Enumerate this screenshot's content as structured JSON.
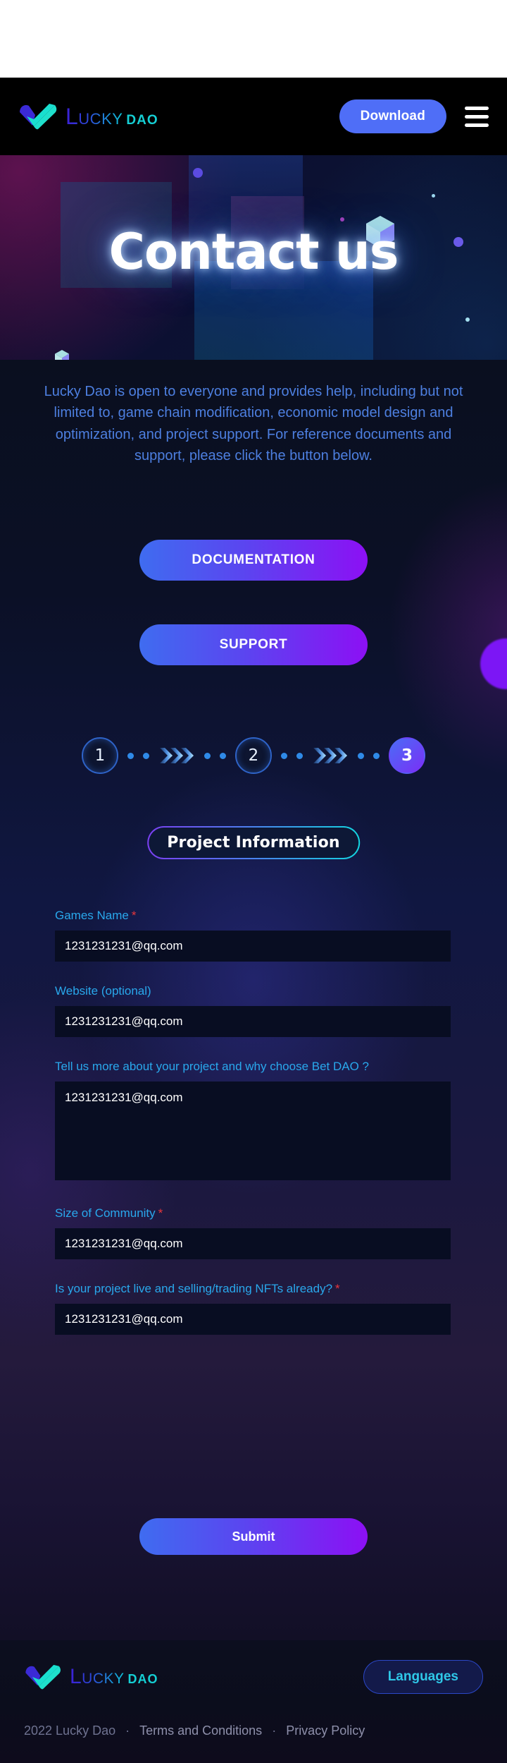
{
  "brand": {
    "name_primary": "Lucky",
    "name_secondary": "DAO",
    "logo_icon": "checkmark-logo-icon"
  },
  "header": {
    "download_label": "Download",
    "menu_icon": "hamburger-menu-icon"
  },
  "hero": {
    "title": "Contact us",
    "cube_icon": "isometric-cube-icon"
  },
  "intro": {
    "paragraph": "Lucky Dao is open to everyone and provides help, including but not limited to, game chain modification, economic model design and optimization, and project support. For reference documents and support, please click the button below."
  },
  "actions": {
    "documentation_label": "DOCUMENTATION",
    "support_label": "SUPPORT"
  },
  "stepper": {
    "steps": [
      {
        "number": "1",
        "state": "idle"
      },
      {
        "number": "2",
        "state": "idle"
      },
      {
        "number": "3",
        "state": "active"
      }
    ],
    "chevron_icon": "chevron-double-right-icon",
    "dot_icon": "progress-dot-icon"
  },
  "section": {
    "tab_label": "Project Information"
  },
  "form": {
    "required_marker": "*",
    "fields": [
      {
        "label": "Games Name",
        "required": true,
        "type": "input",
        "value": "1231231231@qq.com",
        "placeholder": "1231231231@qq.com"
      },
      {
        "label": "Website (optional)",
        "required": false,
        "type": "input",
        "value": "1231231231@qq.com",
        "placeholder": "1231231231@qq.com"
      },
      {
        "label": "Tell us more about your project and why choose Bet DAO ?",
        "required": false,
        "type": "textarea",
        "value": "1231231231@qq.com",
        "placeholder": "1231231231@qq.com"
      },
      {
        "label": "Size of Community",
        "required": true,
        "type": "input",
        "value": "1231231231@qq.com",
        "placeholder": "1231231231@qq.com"
      },
      {
        "label": "Is your project live and selling/trading NFTs already?",
        "required": true,
        "type": "input",
        "value": "1231231231@qq.com",
        "placeholder": "1231231231@qq.com"
      }
    ],
    "submit_label": "Submit"
  },
  "footer": {
    "languages_label": "Languages",
    "copyright": "2022 Lucky Dao",
    "separator": "·",
    "terms_label": "Terms and Conditions",
    "privacy_label": "Privacy Policy"
  },
  "colors": {
    "accent_blue": "#4f6ef7",
    "accent_purple": "#8c10f4",
    "label_cyan": "#29a8ec",
    "required_red": "#e8363b",
    "lead_text": "#4d7fe0",
    "logo_teal": "#15cfd4"
  }
}
